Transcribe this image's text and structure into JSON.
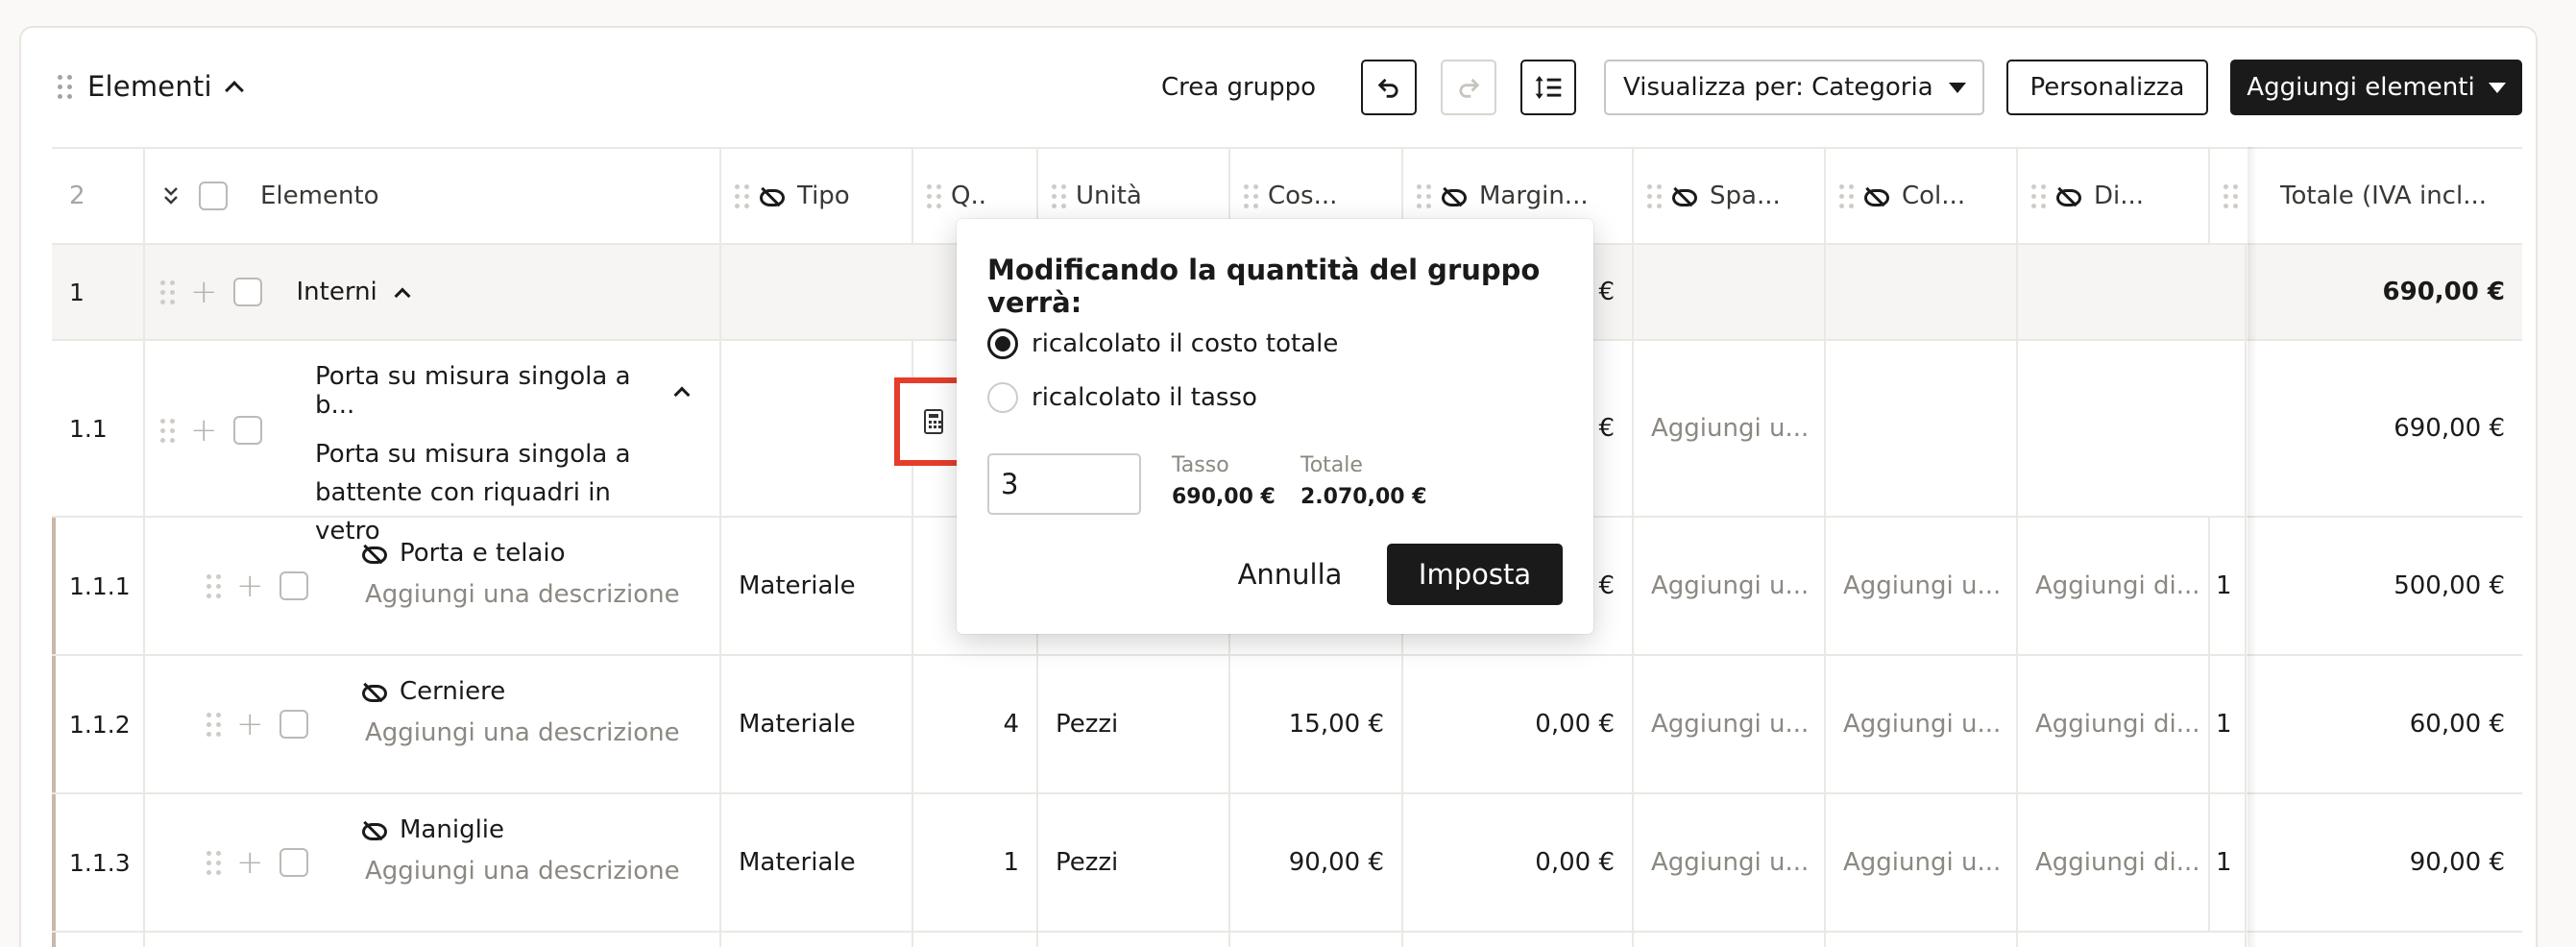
{
  "toolbar": {
    "title": "Elementi",
    "create_group": "Crea gruppo",
    "view_by": "Visualizza per: Categoria",
    "customize": "Personalizza",
    "add_items": "Aggiungi elementi"
  },
  "header": {
    "row_count": "2",
    "element": "Elemento",
    "type": "Tipo",
    "qty": "Q..",
    "unit": "Unità",
    "cost": "Cos...",
    "margin": "Margin...",
    "spa": "Spa...",
    "col": "Col...",
    "di": "Di...",
    "total": "Totale (IVA incl..."
  },
  "group": {
    "index": "1",
    "name": "Interni",
    "cost_tail": "€",
    "total": "690,00 €"
  },
  "parent": {
    "index": "1.1",
    "title": "Porta su misura singola a b...",
    "description": "Porta su misura singola a battente con riquadri in vetro",
    "cost_tail": "€",
    "spa_placeholder": "Aggiungi u...",
    "total": "690,00 €"
  },
  "rows": [
    {
      "index": "1.1.1",
      "name": "Porta e telaio",
      "description": "Aggiungi una descrizione",
      "type": "Materiale",
      "qty": "",
      "unit": "",
      "cost": "",
      "margin": "€",
      "spa": "Aggiungi u...",
      "col": "Aggiungi u...",
      "di": "Aggiungi di...",
      "edge": "1",
      "total": "500,00 €"
    },
    {
      "index": "1.1.2",
      "name": "Cerniere",
      "description": "Aggiungi una descrizione",
      "type": "Materiale",
      "qty": "4",
      "unit": "Pezzi",
      "cost": "15,00 €",
      "margin": "0,00 €",
      "spa": "Aggiungi u...",
      "col": "Aggiungi u...",
      "di": "Aggiungi di...",
      "edge": "1",
      "total": "60,00 €"
    },
    {
      "index": "1.1.3",
      "name": "Maniglie",
      "description": "Aggiungi una descrizione",
      "type": "Materiale",
      "qty": "1",
      "unit": "Pezzi",
      "cost": "90,00 €",
      "margin": "0,00 €",
      "spa": "Aggiungi u...",
      "col": "Aggiungi u...",
      "di": "Aggiungi di...",
      "edge": "1",
      "total": "90,00 €"
    }
  ],
  "popover": {
    "title": "Modificando la quantità del gruppo verrà:",
    "option_total": "ricalcolato il costo totale",
    "option_rate": "ricalcolato il tasso",
    "quantity_value": "3",
    "rate_label": "Tasso",
    "rate_value": "690,00 €",
    "total_label": "Totale",
    "total_value": "2.070,00 €",
    "cancel": "Annulla",
    "set": "Imposta"
  }
}
